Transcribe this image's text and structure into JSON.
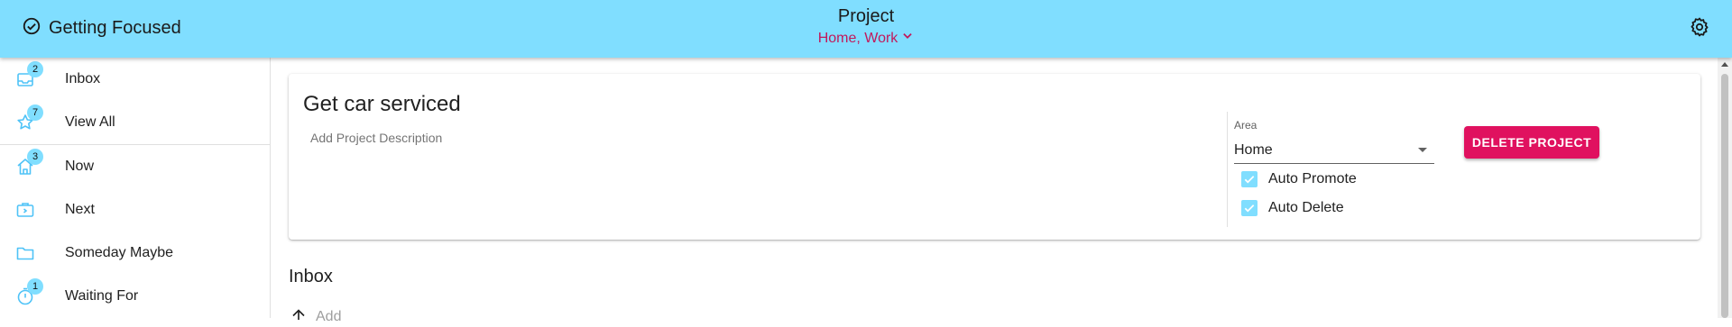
{
  "app": {
    "title": "Getting Focused"
  },
  "header": {
    "title": "Project",
    "areas": "Home, Work"
  },
  "sidebar": {
    "items": [
      {
        "label": "Inbox",
        "badge": "2"
      },
      {
        "label": "View All",
        "badge": "7"
      },
      {
        "label": "Now",
        "badge": "3"
      },
      {
        "label": "Next",
        "badge": ""
      },
      {
        "label": "Someday Maybe",
        "badge": ""
      },
      {
        "label": "Waiting For",
        "badge": "1"
      }
    ]
  },
  "project": {
    "name": "Get car serviced",
    "description_placeholder": "Add Project Description",
    "area_label": "Area",
    "area_value": "Home",
    "auto_promote_label": "Auto Promote",
    "auto_delete_label": "Auto Delete",
    "delete_label": "DELETE PROJECT"
  },
  "inbox": {
    "title": "Inbox",
    "add_placeholder": "Add"
  },
  "colors": {
    "accent": "#80deff",
    "brand": "#c2185b",
    "danger": "#e0115f"
  }
}
